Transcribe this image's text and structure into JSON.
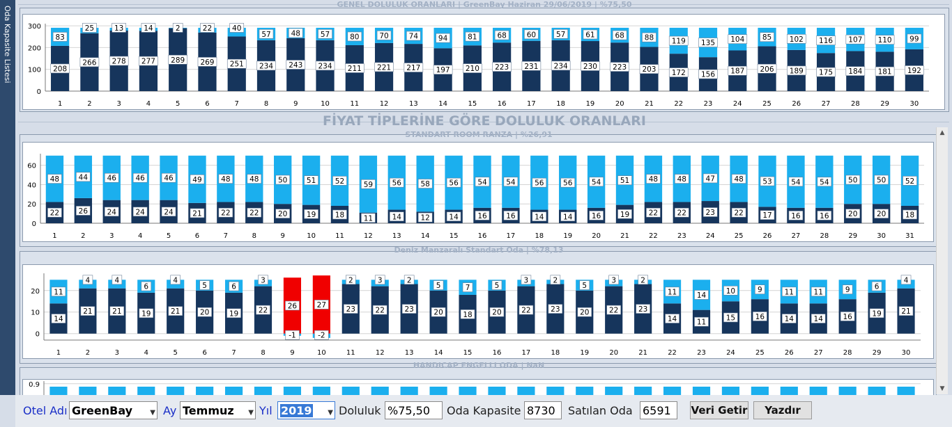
{
  "sidebar": {
    "tab_label": "Oda Kapasite Listesi"
  },
  "headings": {
    "fiyat_title": "FİYAT TİPLERİNE GÖRE DOLULUK ORANLARI"
  },
  "toolbar": {
    "otel_label": "Otel Adı",
    "otel_value": "GreenBay",
    "ay_label": "Ay",
    "ay_value": "Temmuz",
    "yil_label": "Yıl",
    "yil_value": "2019",
    "doluluk_label": "Doluluk",
    "doluluk_value": "%75,50",
    "kapasite_label": "Oda Kapasite",
    "kapasite_value": "8730",
    "satilan_label": "Satılan Oda",
    "satilan_value": "6591",
    "veri_getir": "Veri Getir",
    "yazdir": "Yazdır"
  },
  "colors": {
    "sold": "#16355c",
    "free": "#1bafee",
    "over": "#f00000",
    "label_bg": "#ffffff",
    "title": "#a3b1c5"
  },
  "chart_data": [
    {
      "type": "bar",
      "stacked": true,
      "title": "GENEL DOLULUK ORANLARI | GreenBay Haziran     29/06/2019   |  %75,50",
      "categories": [
        "1",
        "2",
        "3",
        "4",
        "5",
        "6",
        "7",
        "8",
        "9",
        "10",
        "11",
        "12",
        "13",
        "14",
        "15",
        "16",
        "17",
        "18",
        "19",
        "20",
        "21",
        "22",
        "23",
        "24",
        "25",
        "26",
        "27",
        "28",
        "29",
        "30"
      ],
      "series": [
        {
          "values": [
            208,
            266,
            278,
            277,
            289,
            269,
            251,
            234,
            243,
            234,
            211,
            221,
            217,
            197,
            210,
            223,
            231,
            234,
            230,
            223,
            203,
            172,
            156,
            187,
            206,
            189,
            175,
            184,
            181,
            192
          ]
        },
        {
          "values": [
            83,
            25,
            13,
            14,
            2,
            22,
            40,
            57,
            48,
            57,
            80,
            70,
            74,
            94,
            81,
            68,
            60,
            57,
            61,
            68,
            88,
            119,
            135,
            104,
            85,
            102,
            116,
            107,
            110,
            99
          ]
        }
      ],
      "yticks": [
        0,
        100,
        200,
        300
      ],
      "ylim": [
        0,
        310
      ],
      "grid": true
    },
    {
      "type": "bar",
      "stacked": true,
      "title": "STANDART ROOM RANZA | %26,91",
      "categories": [
        "1",
        "2",
        "3",
        "4",
        "5",
        "6",
        "7",
        "8",
        "9",
        "10",
        "11",
        "12",
        "13",
        "14",
        "15",
        "16",
        "17",
        "18",
        "19",
        "20",
        "21",
        "22",
        "23",
        "24",
        "25",
        "26",
        "27",
        "28",
        "29",
        "30",
        "31"
      ],
      "series": [
        {
          "values": [
            22,
            26,
            24,
            24,
            24,
            21,
            22,
            22,
            20,
            19,
            18,
            11,
            14,
            12,
            14,
            16,
            16,
            14,
            14,
            16,
            19,
            22,
            22,
            23,
            22,
            17,
            16,
            16,
            20,
            20,
            18
          ]
        },
        {
          "values": [
            48,
            44,
            46,
            46,
            46,
            49,
            48,
            48,
            50,
            51,
            52,
            59,
            56,
            58,
            56,
            54,
            54,
            56,
            56,
            54,
            51,
            48,
            48,
            47,
            48,
            53,
            54,
            54,
            50,
            50,
            52
          ]
        }
      ],
      "yticks": [
        0,
        20,
        40,
        60
      ],
      "ylim": [
        0,
        72
      ],
      "grid": true
    },
    {
      "type": "bar",
      "stacked": true,
      "title": "Deniz Manzaralı Standart Oda | %78,13",
      "categories": [
        "1",
        "2",
        "3",
        "4",
        "5",
        "6",
        "7",
        "8",
        "9",
        "10",
        "11",
        "12",
        "13",
        "14",
        "15",
        "16",
        "17",
        "18",
        "19",
        "20",
        "21",
        "22",
        "23",
        "24",
        "25",
        "26",
        "27",
        "28",
        "29",
        "30"
      ],
      "series": [
        {
          "values": [
            14,
            21,
            21,
            19,
            21,
            20,
            19,
            22,
            26,
            27,
            23,
            22,
            23,
            20,
            18,
            20,
            22,
            23,
            20,
            22,
            23,
            14,
            11,
            15,
            16,
            14,
            14,
            16,
            19,
            21
          ]
        },
        {
          "values": [
            11,
            4,
            4,
            6,
            4,
            5,
            6,
            3,
            -1,
            -2,
            2,
            3,
            2,
            5,
            7,
            5,
            3,
            2,
            5,
            3,
            2,
            11,
            14,
            10,
            9,
            11,
            11,
            9,
            6,
            4
          ]
        }
      ],
      "yticks": [
        0,
        10,
        20
      ],
      "ylim": [
        -3,
        28
      ],
      "grid": true
    },
    {
      "type": "bar",
      "stacked": true,
      "title": "HANDICAP ENGELLI ODA | NaN",
      "categories": [
        "1",
        "2",
        "3",
        "4",
        "5",
        "6",
        "7",
        "8",
        "9",
        "10",
        "11",
        "12",
        "13",
        "14",
        "15",
        "16",
        "17",
        "18",
        "19",
        "20",
        "21",
        "22",
        "23",
        "24",
        "25",
        "26",
        "27",
        "28",
        "29",
        "30"
      ],
      "yticks": [
        0.9
      ],
      "ylim": [
        0,
        1
      ]
    }
  ]
}
